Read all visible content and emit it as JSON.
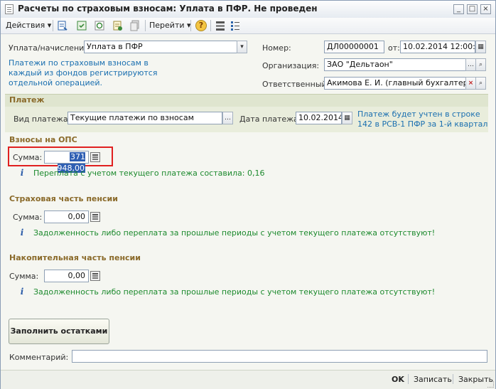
{
  "window": {
    "title": "Расчеты по страховым взносам: Уплата в ПФР. Не проведен",
    "min_label": "_",
    "max_label": "□",
    "close_label": "×"
  },
  "toolbar": {
    "actions_label": "Действия",
    "goto_label": "Перейти",
    "help_label": "?",
    "dropdown_arrow": "▾"
  },
  "header": {
    "payment_type_label": "Уплата/начисление:",
    "payment_type_value": "Уплата в ПФР",
    "note": "Платежи по страховым взносам в каждый из фондов регистрируются отдельной операцией.",
    "number_label": "Номер:",
    "number_value": "ДЛ00000001",
    "date_from_label": "от:",
    "date_value": "10.02.2014 12:00:00",
    "org_label": "Организация:",
    "org_value": "ЗАО \"Дельтаон\"",
    "responsible_label": "Ответственный:",
    "responsible_value": "Акимова Е. И. (главный бухгалтер)"
  },
  "payment": {
    "section_title": "Платеж",
    "kind_label": "Вид платежа:",
    "kind_value": "Текущие платежи по взносам",
    "date_label": "Дата платежа:",
    "date_value": "10.02.2014",
    "hint": "Платеж будет учтен в строке 142 в РСВ-1 ПФР за 1-й квартал"
  },
  "ops": {
    "section_title": "Взносы на ОПС",
    "sum_label": "Сумма:",
    "sum_value": "371 948,00",
    "info": "Переплата с учетом текущего платежа составила: 0,16"
  },
  "insurance": {
    "section_title": "Страховая часть пенсии",
    "sum_label": "Сумма:",
    "sum_value": "0,00",
    "info": "Задолженность либо переплата за прошлые периоды с учетом текущего платежа отсутствуют!"
  },
  "funded": {
    "section_title": "Накопительная часть пенсии",
    "sum_label": "Сумма:",
    "sum_value": "0,00",
    "info": "Задолженность либо переплата за прошлые периоды с учетом текущего платежа отсутствуют!"
  },
  "fill_button_label": "Заполнить остатками",
  "comment": {
    "label": "Комментарий:",
    "value": ""
  },
  "footer": {
    "ok_label": "OK",
    "save_label": "Записать",
    "close_label": "Закрыть"
  },
  "colors": {
    "highlight": "#e02020",
    "section_bg": "#dfe5cf",
    "section_title": "#8a6a2a",
    "hint_blue": "#1a6fb0",
    "info_green": "#1d8a2e"
  }
}
